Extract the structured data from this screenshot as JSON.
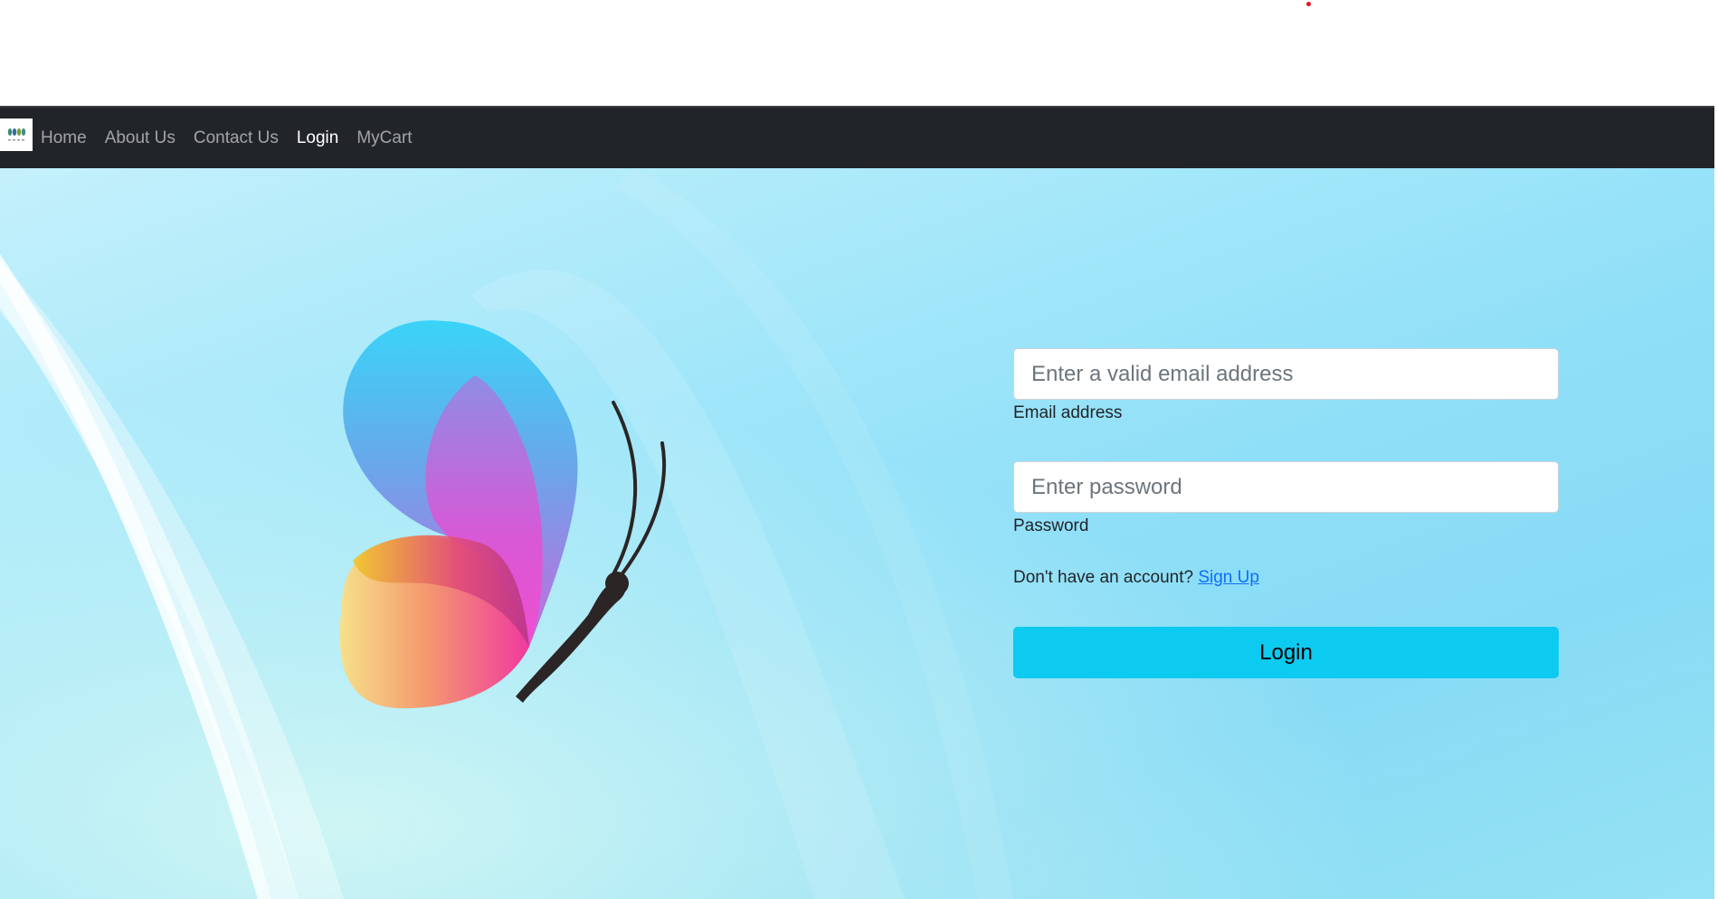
{
  "nav": {
    "brand_icon": "logo-icon",
    "links": [
      {
        "label": "Home",
        "active": false
      },
      {
        "label": "About Us",
        "active": false
      },
      {
        "label": "Contact Us",
        "active": false
      },
      {
        "label": "Login",
        "active": true
      },
      {
        "label": "MyCart",
        "active": false
      }
    ]
  },
  "hero": {
    "image_icon": "butterfly-icon"
  },
  "login_form": {
    "email": {
      "placeholder": "Enter a valid email address",
      "value": "",
      "label": "Email address"
    },
    "password": {
      "placeholder": "Enter password",
      "value": "",
      "label": "Password"
    },
    "signup_prompt": "Don't have an account?",
    "signup_link": "Sign Up",
    "submit_label": "Login"
  },
  "colors": {
    "navbar": "#212529",
    "button": "#0dcaf0",
    "link": "#0d6efd",
    "hero_bg": "#8fdff8"
  }
}
